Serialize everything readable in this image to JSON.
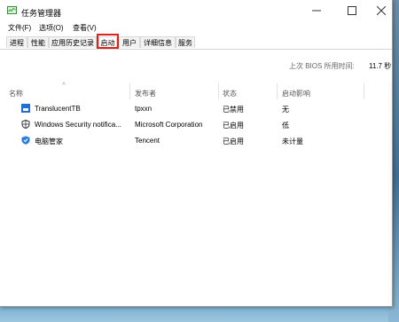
{
  "window": {
    "title": "任务管理器",
    "controls": {
      "minimize": "—",
      "maximize": "☐",
      "close": "✕"
    }
  },
  "menu": [
    "文件(F)",
    "选项(O)",
    "查看(V)"
  ],
  "tabs": [
    {
      "label": "进程"
    },
    {
      "label": "性能"
    },
    {
      "label": "应用历史记录"
    },
    {
      "label": "启动",
      "active": true
    },
    {
      "label": "用户"
    },
    {
      "label": "详细信息"
    },
    {
      "label": "服务"
    }
  ],
  "bios": {
    "label": "上次 BIOS 所用时间:",
    "value": "11.7 秒"
  },
  "table": {
    "sort_indicator": "^",
    "columns": [
      "名称",
      "发布者",
      "状态",
      "启动影响"
    ],
    "rows": [
      {
        "icon": "translucenttb-icon",
        "name": "TranslucentTB",
        "publisher": "tpxxn",
        "status": "已禁用",
        "impact": "无"
      },
      {
        "icon": "shield-icon",
        "name": "Windows Security notifica...",
        "publisher": "Microsoft Corporation",
        "status": "已启用",
        "impact": "低"
      },
      {
        "icon": "pc-manager-icon",
        "name": "电脑管家",
        "publisher": "Tencent",
        "status": "已启用",
        "impact": "未计量"
      }
    ]
  },
  "colors": {
    "highlight_box": "#e0201d",
    "translucenttb_icon": "#1f6fd1",
    "pc_manager_icon": "#2b7be0"
  }
}
